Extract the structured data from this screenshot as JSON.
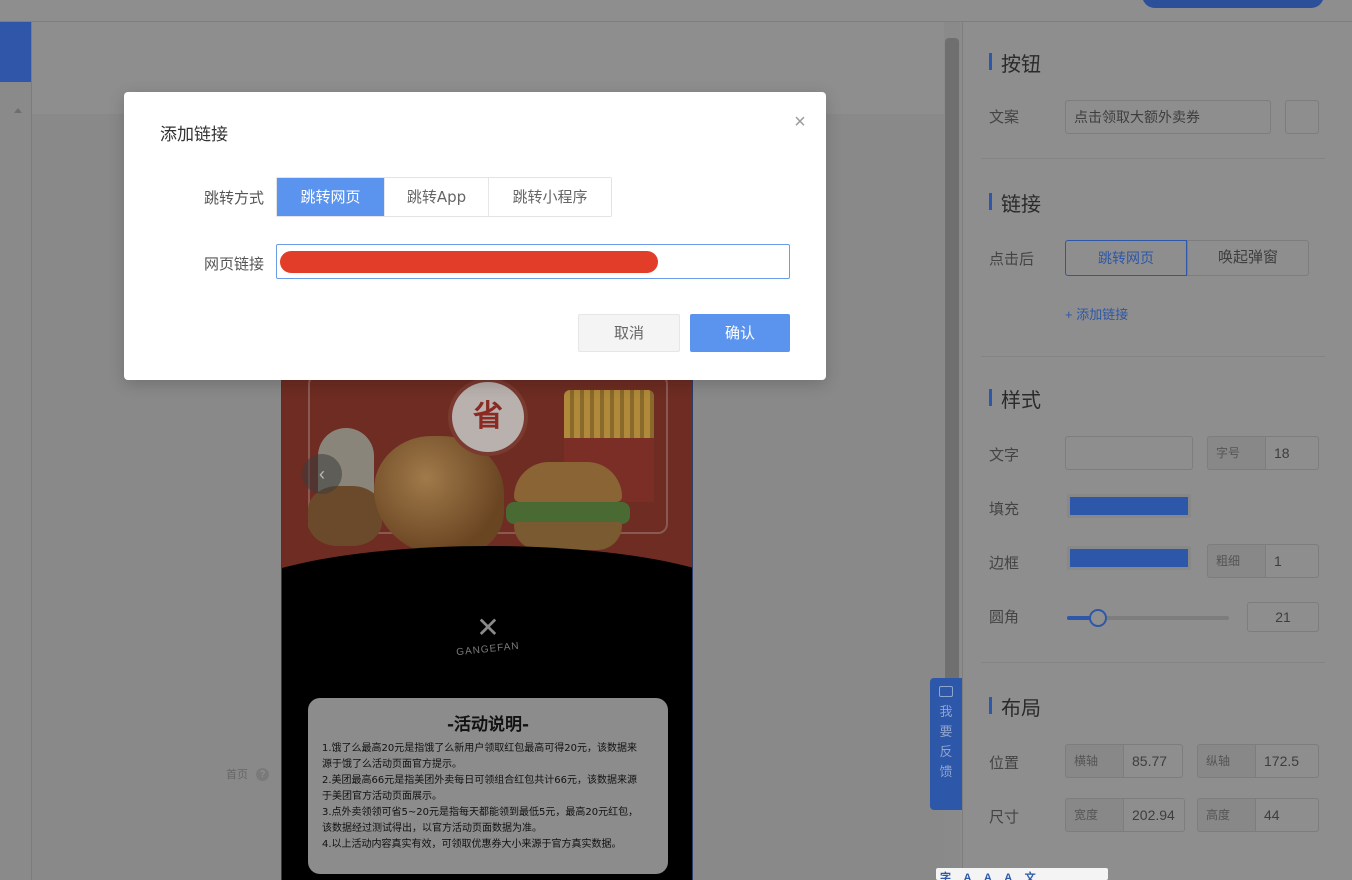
{
  "modal": {
    "title": "添加链接",
    "close_icon": "×",
    "jump_label": "跳转方式",
    "jump_options": [
      "跳转网页",
      "跳转App",
      "跳转小程序"
    ],
    "jump_selected": "跳转网页",
    "url_label": "网页链接",
    "url_value": "",
    "cancel_label": "取消",
    "confirm_label": "确认",
    "accent_color": "#5b94ee",
    "redaction_color": "#e23d28"
  },
  "canvas": {
    "page_note": "首页",
    "poster": {
      "badge_text": "省",
      "brand_text": "GANGEFAN",
      "activity_title": "-活动说明-",
      "activity_lines": [
        "1.饿了么最高20元是指饿了么新用户领取红包最高可得20元，该数据来",
        "源于饿了么活动页面官方提示。",
        "2.美团最高66元是指美团外卖每日可领组合红包共计66元，该数据来源",
        "于美团官方活动页面展示。",
        "3.点外卖领领可省5~20元是指每天都能领到最低5元，最高20元红包，",
        "该数据经过测试得出，以官方活动页面数据为准。",
        "4.以上活动内容真实有效，可领取优惠券大小来源于官方真实数据。"
      ]
    }
  },
  "feedback": {
    "text": "我要反馈"
  },
  "panel": {
    "button_section": {
      "title": "按钮",
      "copy_label": "文案",
      "copy_value": "点击领取大额外卖券"
    },
    "link_section": {
      "title": "链接",
      "after_click_label": "点击后",
      "options": [
        "跳转网页",
        "唤起弹窗"
      ],
      "selected": "跳转网页",
      "add_link": "+ 添加链接"
    },
    "style_section": {
      "title": "样式",
      "text_label": "文字",
      "font_size_label": "字号",
      "font_size_value": "18",
      "fill_label": "填充",
      "fill_color": "#2d57a8",
      "border_label": "边框",
      "border_color": "#2d57a8",
      "border_width_label": "粗细",
      "border_width_value": "1",
      "radius_label": "圆角",
      "radius_value": "21"
    },
    "layout_section": {
      "title": "布局",
      "position_label": "位置",
      "x_label": "横轴",
      "x_value": "85.77",
      "y_label": "纵轴",
      "y_value": "172.5",
      "size_label": "尺寸",
      "width_label": "宽度",
      "width_value": "202.94",
      "height_label": "高度",
      "height_value": "44"
    }
  },
  "bottom_toolbar": [
    "字",
    "A",
    "A",
    "A",
    "文"
  ]
}
